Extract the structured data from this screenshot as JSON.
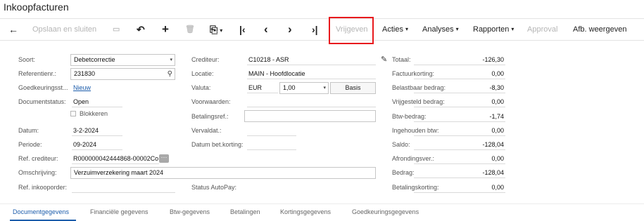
{
  "page_title": "Inkoopfacturen",
  "toolbar": {
    "save_close": "Opslaan en sluiten",
    "release": "Vrijgeven",
    "actions": "Acties",
    "analyses": "Analyses",
    "reports": "Rapporten",
    "approve": "Approval",
    "reject": "Afb. weergeven"
  },
  "icons": {
    "back": "←",
    "save": "▭",
    "undo": "↶",
    "add": "+",
    "delete": "🗑",
    "copy_paste": "⎘",
    "first": "|‹",
    "prev": "‹",
    "next": "›",
    "last": "›|",
    "dropdown": "▾",
    "search": "⚲",
    "edit": "✎",
    "more": "···"
  },
  "left": {
    "type_label": "Soort:",
    "type_value": "Debetcorrectie",
    "refnr_label": "Referentienr.:",
    "refnr_value": "231830",
    "approval_label": "Goedkeuringsst...",
    "approval_value": "Nieuw",
    "docstatus_label": "Documentstatus:",
    "docstatus_value": "Open",
    "block_label": "Blokkeren",
    "date_label": "Datum:",
    "date_value": "3-2-2024",
    "period_label": "Periode:",
    "period_value": "09-2024",
    "vendor_ref_label": "Ref. crediteur:",
    "vendor_ref_value": "R000000042444868-00002Co",
    "desc_label": "Omschrijving:",
    "desc_value": "Verzuimverzekering maart 2024",
    "po_ref_label": "Ref. inkooporder:"
  },
  "middle": {
    "vendor_label": "Crediteur:",
    "vendor_value": "C10218 - ASR",
    "location_label": "Locatie:",
    "location_value": "MAIN - Hoofdlocatie",
    "currency_label": "Valuta:",
    "currency_value": "EUR",
    "rate_value": "1,00",
    "basis_button": "Basis",
    "terms_label": "Voorwaarden:",
    "payref_label": "Betalingsref.:",
    "due_label": "Vervaldat.:",
    "discdate_label": "Datum bet.korting:",
    "autopay_label": "Status AutoPay:"
  },
  "right": {
    "total_label": "Totaal:",
    "total_value": "-126,30",
    "invdisc_label": "Factuurkorting:",
    "invdisc_value": "0,00",
    "taxable_label": "Belastbaar bedrag:",
    "taxable_value": "-8,30",
    "exempt_label": "Vrijgesteld bedrag:",
    "exempt_value": "0,00",
    "vat_label": "Btw-bedrag:",
    "vat_value": "-1,74",
    "withheld_label": "Ingehouden btw:",
    "withheld_value": "0,00",
    "balance_label": "Saldo:",
    "balance_value": "-128,04",
    "rounding_label": "Afrondingsver.:",
    "rounding_value": "0,00",
    "amount_label": "Bedrag:",
    "amount_value": "-128,04",
    "paydisc_label": "Betalingskorting:",
    "paydisc_value": "0,00"
  },
  "tabs": [
    "Documentgegevens",
    "Financiële gegevens",
    "Btw-gegevens",
    "Betalingen",
    "Kortingsgegevens",
    "Goedkeuringsgegevens"
  ],
  "colors": {
    "accent": "#1d5dab",
    "highlight": "#e8191d"
  }
}
